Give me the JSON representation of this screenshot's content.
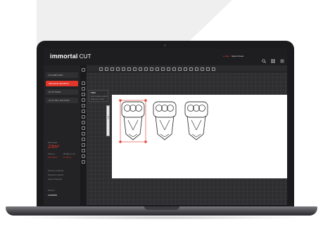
{
  "app": {
    "brand": "immortal",
    "product": "CUT"
  },
  "topbar": {
    "user_mark": "● Main",
    "user_name": "Martin Prado",
    "icons": [
      "search-icon",
      "notification-icon",
      "settings-icon",
      "menu-icon"
    ]
  },
  "sidebar": {
    "items": [
      {
        "label": "DASHBOARD",
        "active": false
      },
      {
        "label": "VEHICLE SEARCH",
        "active": true
      },
      {
        "label": "PLOTTERS",
        "active": false
      },
      {
        "label": "CUTTING HISTORY",
        "active": false
      }
    ],
    "stats": {
      "film_label": "Film used",
      "film_value": "23m²",
      "col_a_label": "Films in",
      "col_a_value": "122 Films",
      "col_b_label": "Ready to cut",
      "col_b_value": "12 Films"
    },
    "links": [
      "Account settings",
      "Payment options",
      "Help & Support"
    ],
    "partner_label": "Partner",
    "partner_name": "CARPRO"
  },
  "panel": {
    "title": "Filter",
    "lines": [
      "Auto nesting enabled",
      "Alignment: center"
    ]
  },
  "vbar_label": "Cut",
  "accent": "#e3362b"
}
